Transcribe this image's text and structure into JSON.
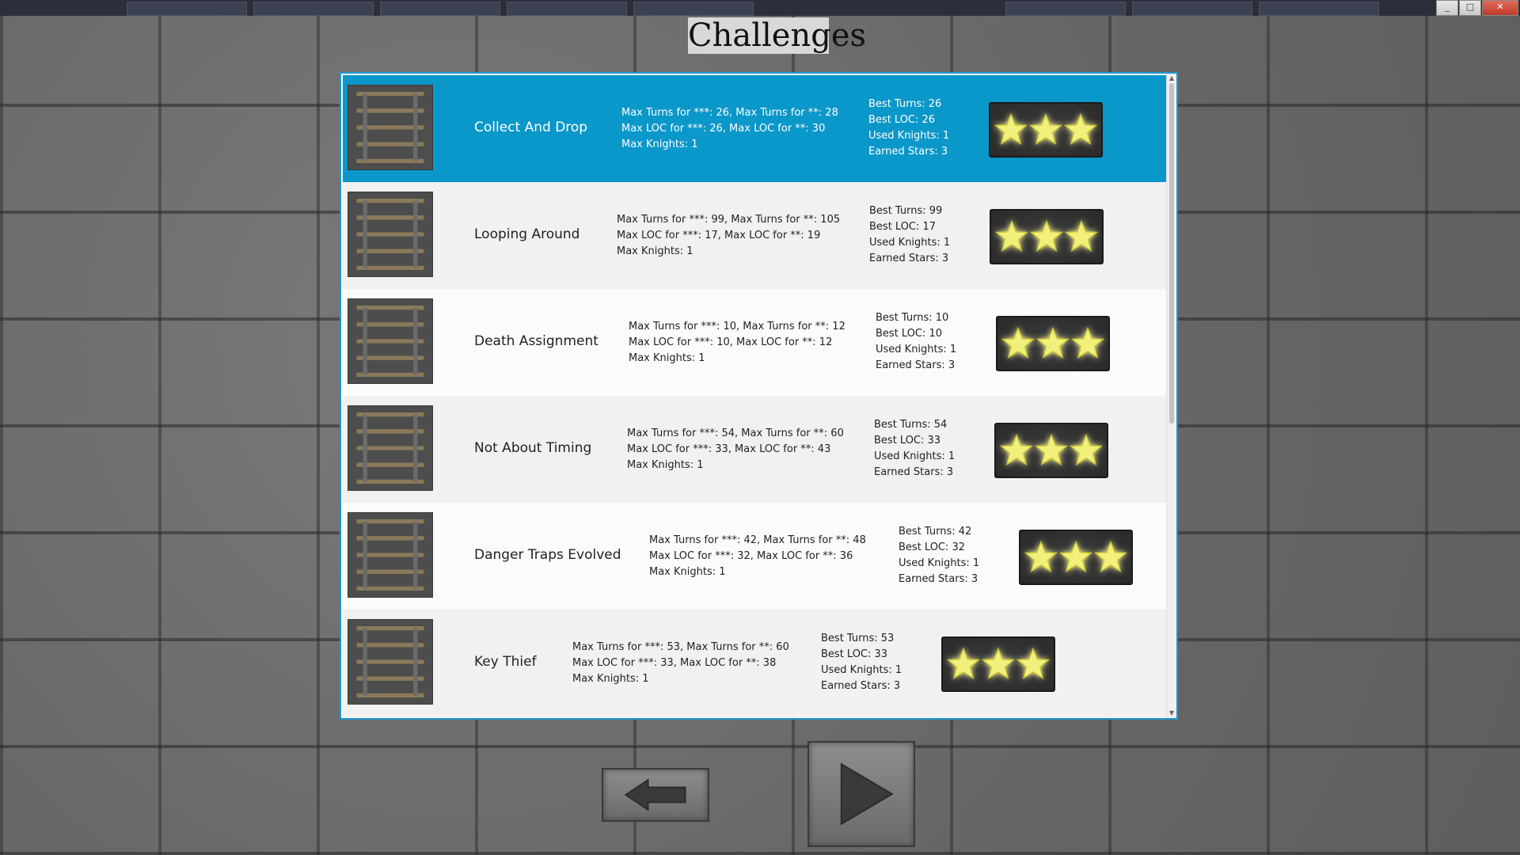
{
  "screen_title": "Challenges",
  "window_buttons": [
    "_",
    "□",
    "✕"
  ],
  "challenges": [
    {
      "name": "Collect And Drop",
      "req_line1": "Max Turns for ***: 26, Max Turns for **: 28",
      "req_line2": "Max LOC for ***: 26, Max LOC for **: 30",
      "req_line3": "Max Knights: 1",
      "best_turns": "Best Turns: 26",
      "best_loc": "Best LOC: 26",
      "used_knights": "Used Knights: 1",
      "earned_stars": "Earned Stars: 3",
      "stars": 3,
      "selected": true
    },
    {
      "name": "Looping Around",
      "req_line1": "Max Turns for ***: 99, Max Turns for **: 105",
      "req_line2": "Max LOC for ***: 17, Max LOC for **: 19",
      "req_line3": "Max Knights: 1",
      "best_turns": "Best Turns: 99",
      "best_loc": "Best LOC: 17",
      "used_knights": "Used Knights: 1",
      "earned_stars": "Earned Stars: 3",
      "stars": 3,
      "selected": false
    },
    {
      "name": "Death Assignment",
      "req_line1": "Max Turns for ***: 10, Max Turns for **: 12",
      "req_line2": "Max LOC for ***: 10, Max LOC for **: 12",
      "req_line3": "Max Knights: 1",
      "best_turns": "Best Turns: 10",
      "best_loc": "Best LOC: 10",
      "used_knights": "Used Knights: 1",
      "earned_stars": "Earned Stars: 3",
      "stars": 3,
      "selected": false
    },
    {
      "name": "Not About Timing",
      "req_line1": "Max Turns for ***: 54, Max Turns for **: 60",
      "req_line2": "Max LOC for ***: 33, Max LOC for **: 43",
      "req_line3": "Max Knights: 1",
      "best_turns": "Best Turns: 54",
      "best_loc": "Best LOC: 33",
      "used_knights": "Used Knights: 1",
      "earned_stars": "Earned Stars: 3",
      "stars": 3,
      "selected": false
    },
    {
      "name": "Danger Traps Evolved",
      "req_line1": "Max Turns for ***: 42, Max Turns for **: 48",
      "req_line2": "Max LOC for ***: 32, Max LOC for **: 36",
      "req_line3": "Max Knights: 1",
      "best_turns": "Best Turns: 42",
      "best_loc": "Best LOC: 32",
      "used_knights": "Used Knights: 1",
      "earned_stars": "Earned Stars: 3",
      "stars": 3,
      "selected": false
    },
    {
      "name": "Key Thief",
      "req_line1": "Max Turns for ***: 53, Max Turns for **: 60",
      "req_line2": "Max LOC for ***: 33, Max LOC for **: 38",
      "req_line3": "Max Knights: 1",
      "best_turns": "Best Turns: 53",
      "best_loc": "Best LOC: 33",
      "used_knights": "Used Knights: 1",
      "earned_stars": "Earned Stars: 3",
      "stars": 3,
      "selected": false
    }
  ],
  "controls": {
    "back_icon": "left-arrow-icon",
    "play_icon": "play-icon"
  },
  "colors": {
    "selected_row": "#0a97c9",
    "panel_border": "#1e98cf",
    "star_fill": "#f1f07a"
  }
}
